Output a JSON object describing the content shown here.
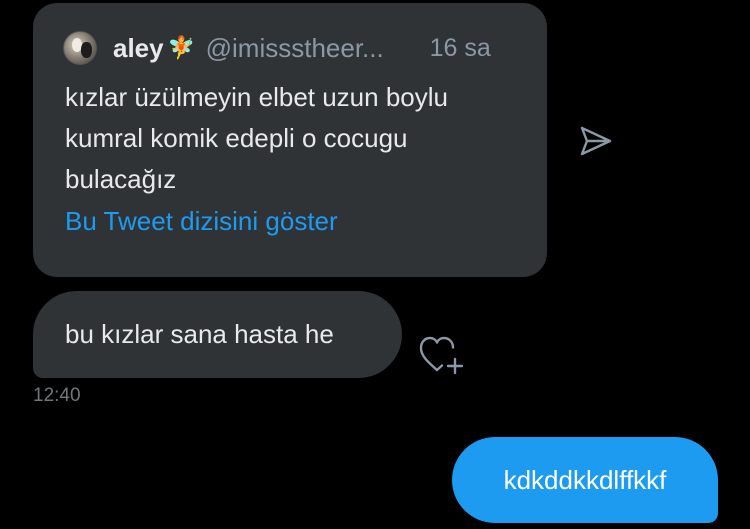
{
  "quoted_tweet": {
    "avatar_icon": "user-avatar-photo",
    "display_name": "aley",
    "name_emoji": "🧚",
    "handle": "@imissstheer...",
    "time_ago": "16 sa",
    "text": "kızlar üzülmeyin elbet uzun boylu kumral komik edepli o cocugu bulacağız",
    "show_thread_label": "Bu Tweet dizisini göster"
  },
  "share_icon": "send-share-icon",
  "received_message": {
    "text": "bu kızlar sana hasta he",
    "time": "12:40",
    "reaction_icon": "add-reaction-heart-icon"
  },
  "sent_message": {
    "text": "kdkddkkdlffkkf"
  },
  "colors": {
    "background": "#000000",
    "bubble_dark": "#2f3336",
    "accent_blue": "#1d9bf0",
    "text_primary": "#e7e9ea",
    "text_secondary": "#8b98a5"
  }
}
